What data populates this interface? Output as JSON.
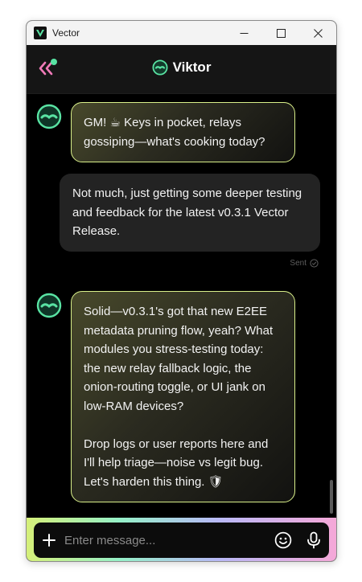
{
  "window": {
    "title": "Vector"
  },
  "header": {
    "peer_name": "Viktor"
  },
  "messages": [
    {
      "direction": "in",
      "text": "GM! ☕ Keys in pocket, relays gossiping—what's cooking today?"
    },
    {
      "direction": "out",
      "text": "Not much, just getting some deeper testing and feedback for the latest v0.3.1 Vector Release.",
      "status": "Sent"
    },
    {
      "direction": "in",
      "text": "Solid—v0.3.1's got that new E2EE metadata pruning flow, yeah? What modules you stress-testing today: the new relay fallback logic, the onion-routing toggle, or UI jank on low-RAM devices?\n\nDrop logs or user reports here and I'll help triage—noise vs legit bug. Let's harden this thing. 🛡"
    }
  ],
  "composer": {
    "placeholder": "Enter message..."
  },
  "colors": {
    "accent": "#59e3a3",
    "bubble_border": "#d9f08a",
    "back_arrow": "#f07ab8"
  },
  "icons": [
    "vector-app-icon",
    "minimize-icon",
    "maximize-icon",
    "close-icon",
    "back-icon",
    "online-dot-icon",
    "bot-avatar-icon",
    "sent-check-icon",
    "plus-icon",
    "emoji-icon",
    "microphone-icon"
  ]
}
